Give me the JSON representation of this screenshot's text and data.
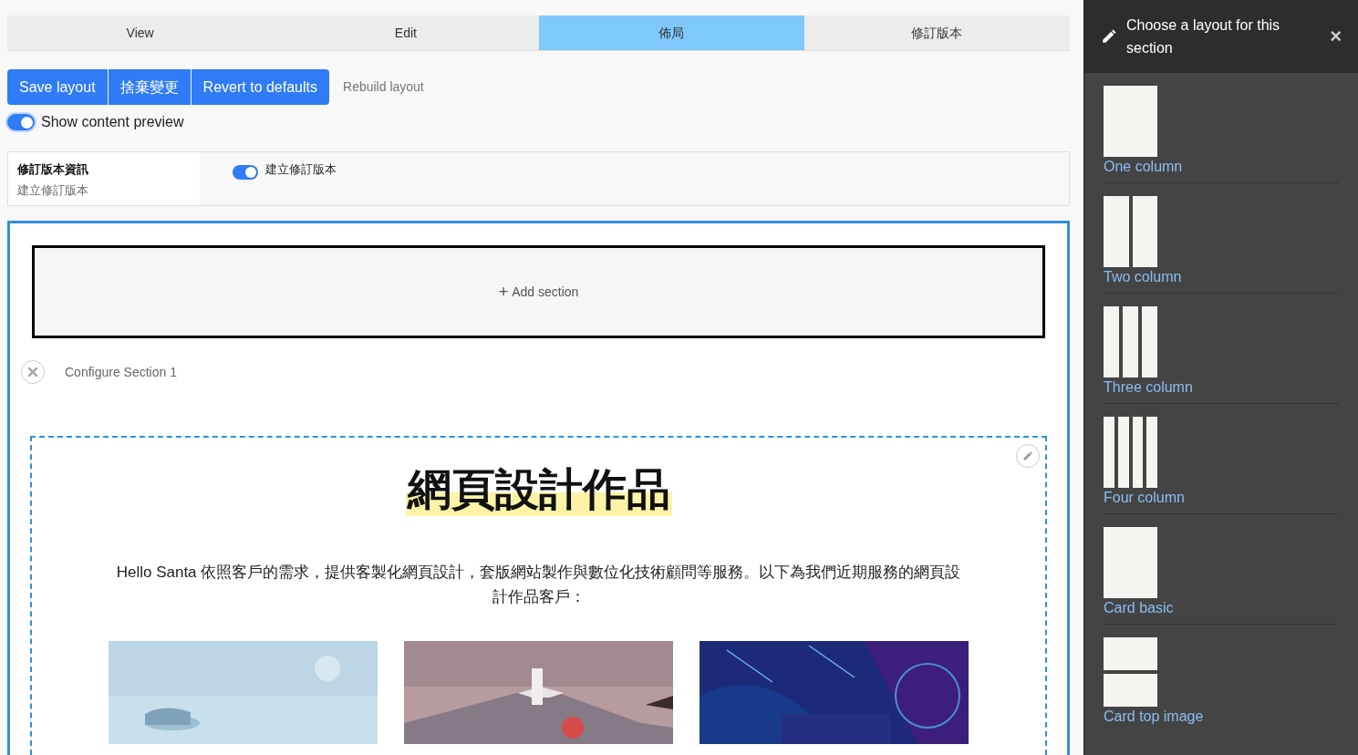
{
  "tabs": [
    {
      "label": "View",
      "selected": false
    },
    {
      "label": "Edit",
      "selected": false
    },
    {
      "label": "佈局",
      "selected": true
    },
    {
      "label": "修訂版本",
      "selected": false
    }
  ],
  "actions": [
    {
      "label": "Save layout",
      "kind": "primary"
    },
    {
      "label": "捨棄變更",
      "kind": "primary"
    },
    {
      "label": "Revert to defaults",
      "kind": "primary"
    },
    {
      "label": "Rebuild layout",
      "kind": "link"
    }
  ],
  "preview_toggle": {
    "label": "Show content preview",
    "on": true
  },
  "revision": {
    "title": "修訂版本資訊",
    "subtitle": "建立修訂版本",
    "toggle": {
      "label": "建立修訂版本",
      "on": true
    }
  },
  "add_section": {
    "icon": "+",
    "label": "Add section"
  },
  "configure": {
    "label": "Configure Section 1"
  },
  "content": {
    "heading": "網頁設計作品",
    "body": "Hello Santa 依照客戶的需求，提供客製化網頁設計，套版網站製作與數位化技術顧問等服務。以下為我們近期服務的網頁設計作品客戶："
  },
  "panel": {
    "title": "Choose a layout for this section",
    "close": "×",
    "layouts": [
      {
        "label": "One column",
        "kind": "one"
      },
      {
        "label": "Two column",
        "kind": "two"
      },
      {
        "label": "Three column",
        "kind": "three"
      },
      {
        "label": "Four column",
        "kind": "four"
      },
      {
        "label": "Card basic",
        "kind": "card"
      },
      {
        "label": "Card top image",
        "kind": "card_top"
      }
    ]
  }
}
